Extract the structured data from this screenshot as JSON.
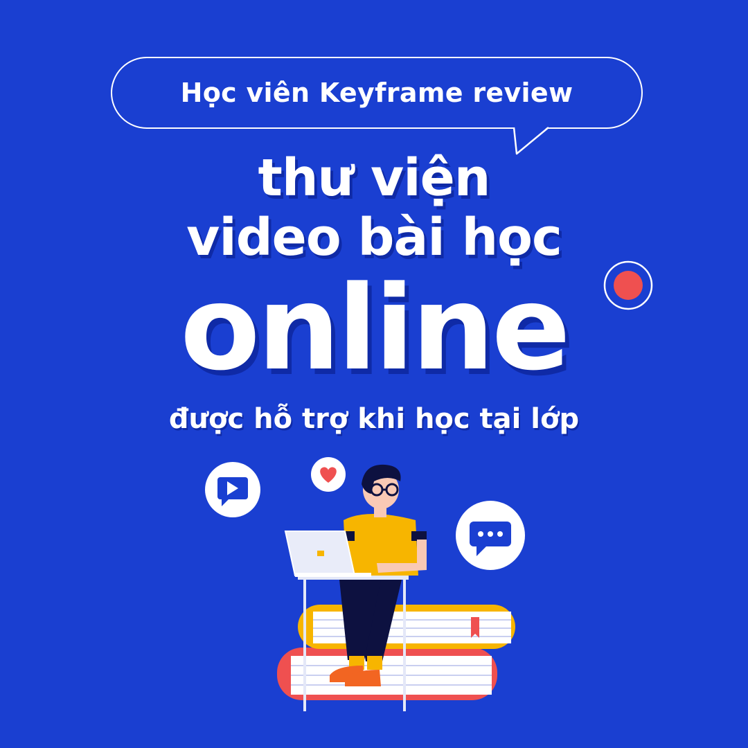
{
  "bubble": {
    "text": "Học viên Keyframe review"
  },
  "headline": {
    "line1": "thư viện",
    "line2": "video bài học",
    "line3": "online",
    "line4": "được hỗ trợ khi học tại lớp"
  },
  "colors": {
    "background": "#1a3fd1",
    "text": "#ffffff",
    "shadow": "#0f2aa6",
    "accent_red": "#ef5050",
    "shirt_yellow": "#f7b500",
    "pants_navy": "#0d1140",
    "shoes_orange": "#f26522"
  },
  "icons": [
    "speech-bubble-tail",
    "record-dot-icon",
    "video-play-icon",
    "heart-icon",
    "chat-dots-icon",
    "laptop-icon",
    "books-stack"
  ]
}
